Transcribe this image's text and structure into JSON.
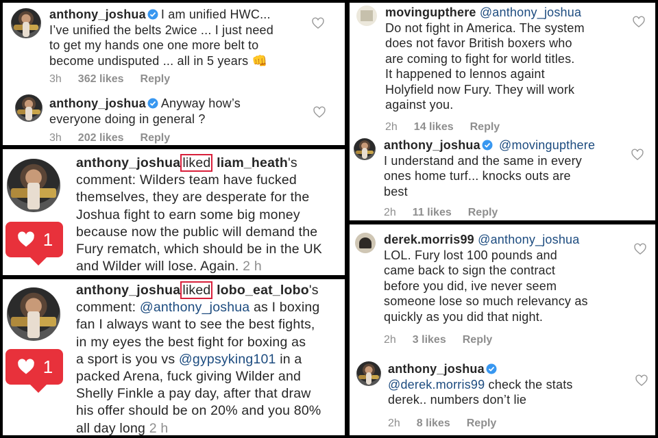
{
  "panel_a": {
    "c1": {
      "user": "anthony_joshua",
      "text_lines": [
        "I am unified HWC...",
        "I’ve unified the belts 2wice ... I just need",
        "to get my hands one one more belt to",
        "become undisputed ... all in 5 years"
      ],
      "emoji": "👊",
      "time": "3h",
      "likes": "362 likes",
      "reply": "Reply"
    },
    "c2": {
      "user": "anthony_joshua",
      "text_lines": [
        "Anyway how’s",
        "everyone doing in general ?"
      ],
      "time": "3h",
      "likes": "202 likes",
      "reply": "Reply"
    }
  },
  "panel_b": {
    "user": "anthony_joshua",
    "liked": "liked",
    "target": "liam_heath",
    "lines": [
      "comment: Wilders team have fucked",
      "themselves, they are desperate for the",
      "Joshua fight to earn some big money",
      "because now the public will demand the",
      "Fury rematch, which should be in the UK",
      "and Wilder will lose. Again."
    ],
    "time": "2 h",
    "badge": "1"
  },
  "panel_c": {
    "user": "anthony_joshua",
    "liked": "liked",
    "target": "lobo_eat_lobo",
    "mention1": "@anthony_joshua",
    "mention2": "@gypsyking101",
    "line1_rest": "as I boxing",
    "lines": [
      "fan I always want to see the best fights,",
      "in my eyes the best fight for boxing as"
    ],
    "line4_pre": "a sport is you vs",
    "line4_post": "in a",
    "lines2": [
      "packed Arena, fuck giving Wilder and",
      "Shelly Finkle a pay day, after that draw",
      "his offer should be on 20% and you 80%"
    ],
    "last": "all day long",
    "time": "2 h",
    "badge": "1"
  },
  "panel_d": {
    "c1": {
      "user": "movingupthere",
      "mention": "@anthony_joshua",
      "lines": [
        "Do not fight in America. The system",
        "does not favor British boxers who",
        "are coming to fight for world titles.",
        "It happened to lennos againt",
        "Holyfield  now Fury. They will work",
        "against you."
      ],
      "time": "2h",
      "likes": "14 likes",
      "reply": "Reply"
    },
    "c2": {
      "user": "anthony_joshua",
      "mention": "@movingupthere",
      "lines": [
        "I understand and the same in every",
        "ones home turf... knocks outs are",
        "best"
      ],
      "time": "2h",
      "likes": "11 likes",
      "reply": "Reply"
    }
  },
  "panel_e": {
    "c1": {
      "user": "derek.morris99",
      "mention": "@anthony_joshua",
      "lines": [
        "LOL. Fury lost 100 pounds and",
        "came back to sign the contract",
        "before you did, ive never seem",
        "someone lose so much relevancy as",
        "quickly as you did that night."
      ],
      "time": "2h",
      "likes": "3 likes",
      "reply": "Reply"
    },
    "c2": {
      "user": "anthony_joshua",
      "mention": "@derek.morris99",
      "rest": "check the stats",
      "line2": "derek.. numbers don’t lie",
      "time": "2h",
      "likes": "8 likes",
      "reply": "Reply"
    }
  },
  "colors": {
    "verified": "#3897f0",
    "mention": "#1c4b7f",
    "badge": "#e8313b",
    "liked_box": "#d81f3a"
  }
}
